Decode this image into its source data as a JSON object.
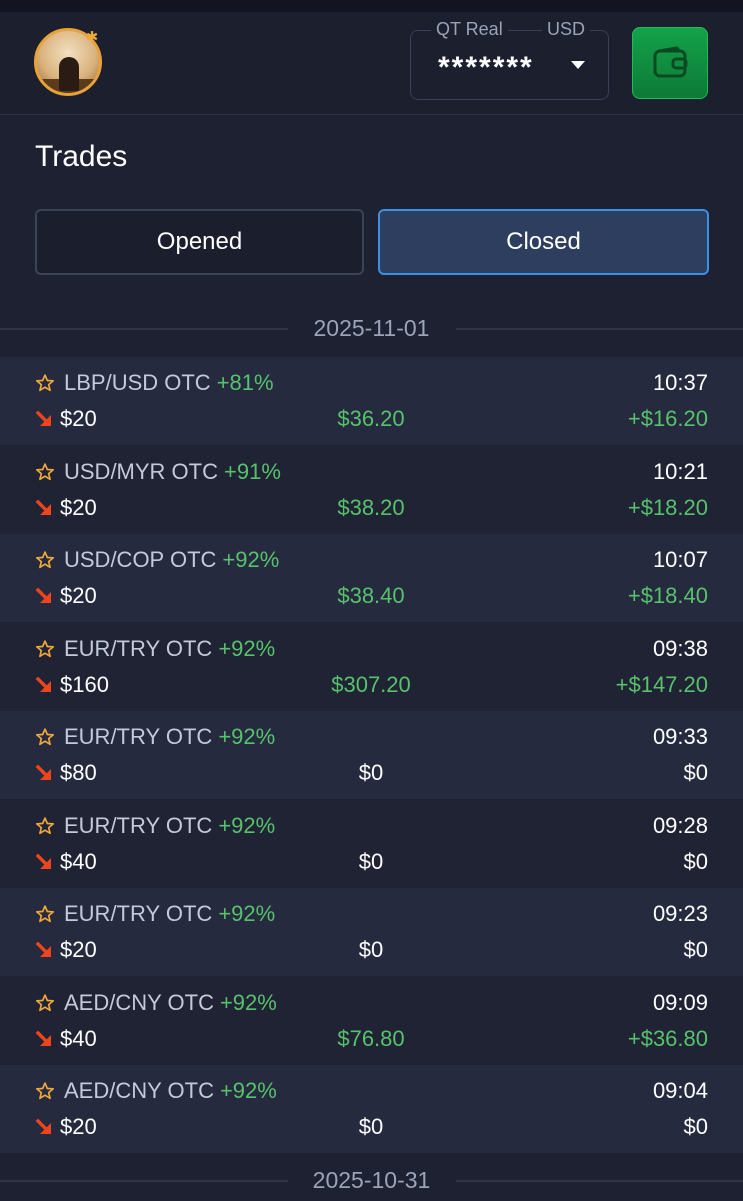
{
  "header": {
    "account_type": "QT Real",
    "currency": "USD",
    "balance_masked": "*******"
  },
  "page_title": "Trades",
  "tabs": [
    {
      "label": "Opened",
      "active": false
    },
    {
      "label": "Closed",
      "active": true
    }
  ],
  "dates": [
    "2025-11-01",
    "2025-10-31"
  ],
  "trades": [
    {
      "pair": "LBP/USD OTC",
      "payout_pct": "+81%",
      "time": "10:37",
      "amount": "$20",
      "payout": "$36.20",
      "profit": "+$16.20",
      "won": true
    },
    {
      "pair": "USD/MYR OTC",
      "payout_pct": "+91%",
      "time": "10:21",
      "amount": "$20",
      "payout": "$38.20",
      "profit": "+$18.20",
      "won": true
    },
    {
      "pair": "USD/COP OTC",
      "payout_pct": "+92%",
      "time": "10:07",
      "amount": "$20",
      "payout": "$38.40",
      "profit": "+$18.40",
      "won": true
    },
    {
      "pair": "EUR/TRY OTC",
      "payout_pct": "+92%",
      "time": "09:38",
      "amount": "$160",
      "payout": "$307.20",
      "profit": "+$147.20",
      "won": true
    },
    {
      "pair": "EUR/TRY OTC",
      "payout_pct": "+92%",
      "time": "09:33",
      "amount": "$80",
      "payout": "$0",
      "profit": "$0",
      "won": false
    },
    {
      "pair": "EUR/TRY OTC",
      "payout_pct": "+92%",
      "time": "09:28",
      "amount": "$40",
      "payout": "$0",
      "profit": "$0",
      "won": false
    },
    {
      "pair": "EUR/TRY OTC",
      "payout_pct": "+92%",
      "time": "09:23",
      "amount": "$20",
      "payout": "$0",
      "profit": "$0",
      "won": false
    },
    {
      "pair": "AED/CNY OTC",
      "payout_pct": "+92%",
      "time": "09:09",
      "amount": "$40",
      "payout": "$76.80",
      "profit": "+$36.80",
      "won": true
    },
    {
      "pair": "AED/CNY OTC",
      "payout_pct": "+92%",
      "time": "09:04",
      "amount": "$20",
      "payout": "$0",
      "profit": "$0",
      "won": false
    }
  ],
  "colors": {
    "background": "#1d2132",
    "positive": "#57c26b",
    "star": "#f2a93b",
    "down_arrow": "#f0441c",
    "active_tab_border": "#3b8fe5",
    "wallet_button": "#14a24a"
  },
  "icons": {
    "favorite": "star-outline-icon",
    "direction": "arrow-down-right-icon",
    "wallet": "wallet-icon",
    "dropdown": "caret-down-icon"
  }
}
